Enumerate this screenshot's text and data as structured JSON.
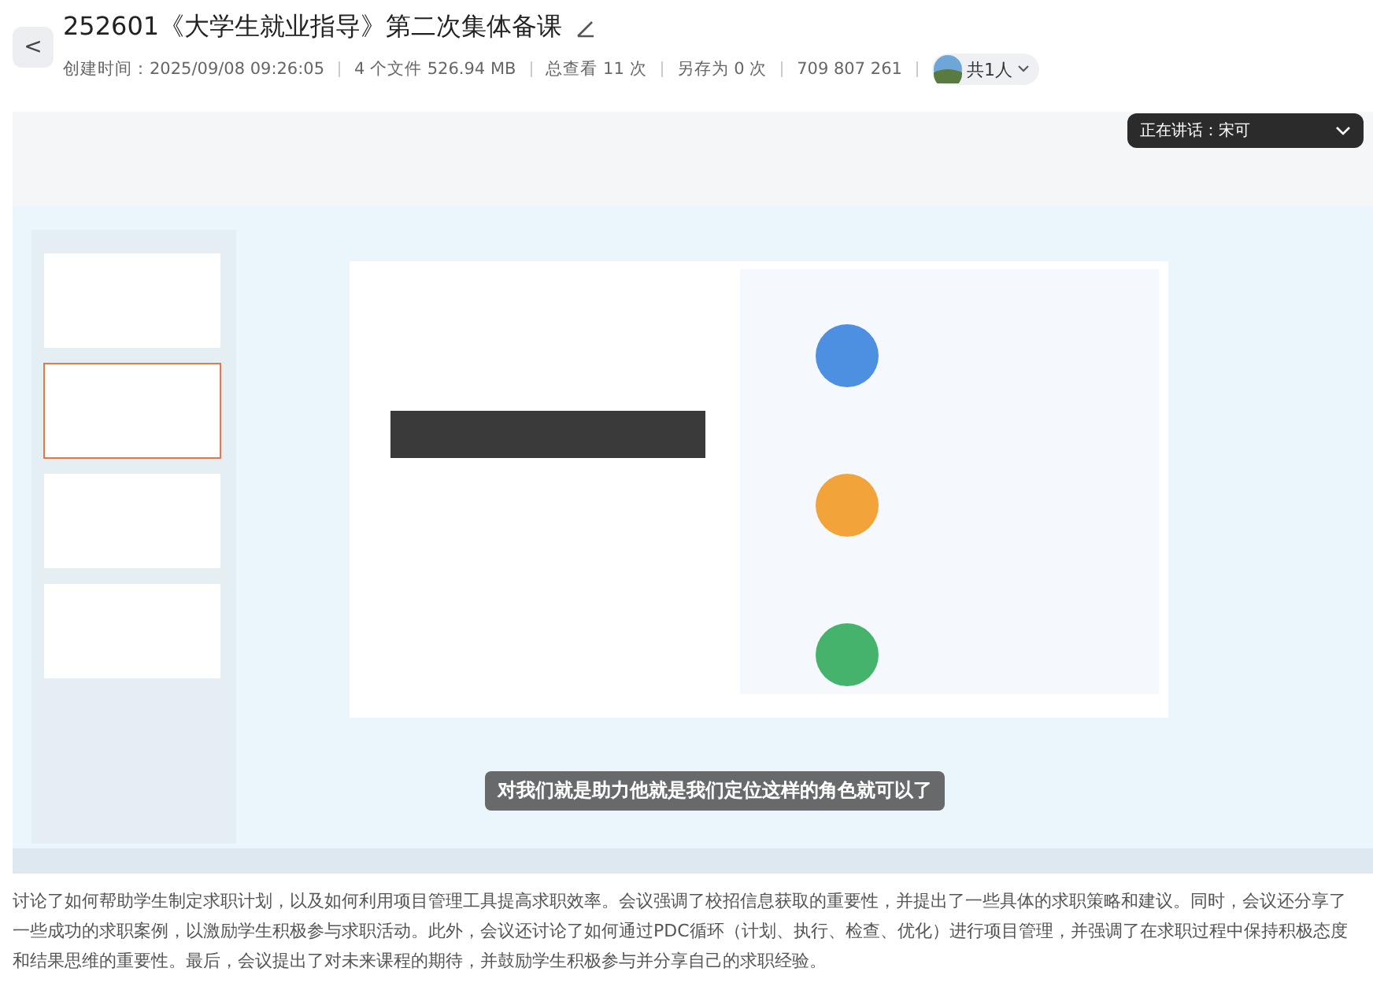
{
  "header": {
    "back": "<",
    "title": "252601《大学生就业指导》第二次集体备课",
    "meta": [
      "创建时间：2025/09/08 09:26:05",
      "4 个文件 526.94 MB",
      "总查看 11 次",
      "另存为 0 次",
      "709 807 261"
    ],
    "participants": "共1人"
  },
  "video": {
    "kind": "picture",
    "speaker": "正在讲话：宋可",
    "subtitle": "对我们就是助力他就是我们定位这样的角色就可以了"
  },
  "summary": "讨论了如何帮助学生制定求职计划，以及如何利用项目管理工具提高求职效率。会议强调了校招信息获取的重要性，并提出了一些具体的求职策略和建议。同时，会议还分享了一些成功的求职案例，以激励学生积极参与求职活动。此外，会议还讨论了如何通过PDC循环（计划、执行、检查、优化）进行项目管理，并强调了在求职过程中保持积极态度和结果思维的重要性。最后，会议提出了对未来课程的期待，并鼓励学生积极参与并分享自己的求职经验。"
}
